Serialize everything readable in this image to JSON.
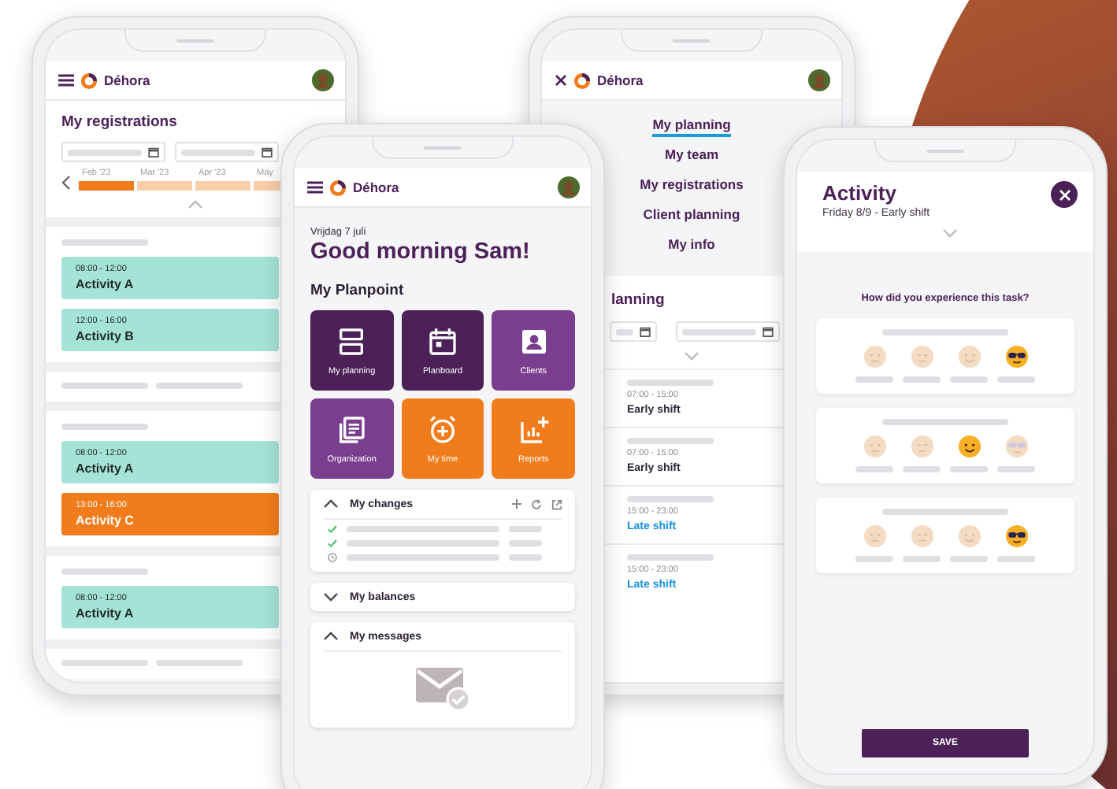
{
  "phones": [
    {
      "kind": "registrations",
      "header": {
        "app_name": "Déhora",
        "menu_open": false
      },
      "title": "My registrations",
      "months": [
        {
          "label": "Feb '23",
          "selected": true
        },
        {
          "label": "Mar '23",
          "selected": false
        },
        {
          "label": "Apr '23",
          "selected": false
        },
        {
          "label": "May",
          "selected": false
        }
      ],
      "groups": [
        {
          "summary_row": true,
          "activities": [
            {
              "time": "08:00 - 12:00",
              "name": "Activity A",
              "color": "#a6e3d7"
            },
            {
              "time": "12:00 - 16:00",
              "name": "Activity B",
              "color": "#a6e3d7"
            }
          ]
        },
        {
          "summary_row": false,
          "activities": [
            {
              "time": "08:00 - 12:00",
              "name": "Activity A",
              "color": "#a6e3d7"
            },
            {
              "time": "13:00 - 16:00",
              "name": "Activity C",
              "color": "#f07c1b"
            }
          ]
        },
        {
          "summary_row": true,
          "activities": [
            {
              "time": "08:00 - 12:00",
              "name": "Activity A",
              "color": "#a6e3d7"
            }
          ]
        }
      ]
    },
    {
      "kind": "home",
      "header": {
        "app_name": "Déhora",
        "menu_open": false
      },
      "date": "Vrijdag 7 juli",
      "greeting": "Good morning Sam!",
      "section_title": "My Planpoint",
      "tiles": [
        {
          "label": "My planning",
          "color": "#4b2158"
        },
        {
          "label": "Planboard",
          "color": "#4b2158"
        },
        {
          "label": "Clients",
          "color": "#7a3e8e"
        },
        {
          "label": "Organization",
          "color": "#7a3e8e"
        },
        {
          "label": "My time",
          "color": "#f07c1b"
        },
        {
          "label": "Reports",
          "color": "#f07c1b"
        }
      ],
      "panels": [
        {
          "title": "My changes",
          "expanded": true,
          "items": [
            {
              "kind": "done"
            },
            {
              "kind": "done"
            },
            {
              "kind": "pending"
            }
          ]
        },
        {
          "title": "My balances",
          "expanded": false
        },
        {
          "title": "My messages",
          "expanded": true
        }
      ]
    },
    {
      "kind": "menu",
      "header": {
        "app_name": "Déhora",
        "menu_open": true
      },
      "nav": [
        {
          "label": "My planning",
          "selected": true
        },
        {
          "label": "My team",
          "selected": false
        },
        {
          "label": "My registrations",
          "selected": false
        },
        {
          "label": "Client planning",
          "selected": false
        },
        {
          "label": "My info",
          "selected": false
        }
      ],
      "title": "lanning",
      "shifts": [
        {
          "time": "07:00 - 15:00",
          "name": "Early shift",
          "color": "#2b2b3a"
        },
        {
          "time": "07:00 - 15:00",
          "name": "Early shift",
          "color": "#2b2b3a"
        },
        {
          "time": "15:00 - 23:00",
          "name": "Late shift",
          "color": "#1a90e0"
        },
        {
          "time": "15:00 - 23:00",
          "name": "Late shift",
          "color": "#1a90e0"
        }
      ]
    },
    {
      "kind": "activity",
      "title": "Activity",
      "subtitle": "Friday 8/9 - Early shift",
      "question": "How did you experience this task?",
      "ratings": [
        {
          "faces": [
            {
              "selected": false
            },
            {
              "selected": false
            },
            {
              "selected": false
            },
            {
              "selected": true
            }
          ]
        },
        {
          "faces": [
            {
              "selected": false
            },
            {
              "selected": false
            },
            {
              "selected": true
            },
            {
              "selected": false
            }
          ]
        },
        {
          "faces": [
            {
              "selected": false
            },
            {
              "selected": false
            },
            {
              "selected": false
            },
            {
              "selected": true
            }
          ]
        }
      ],
      "button": "SAVE"
    }
  ]
}
